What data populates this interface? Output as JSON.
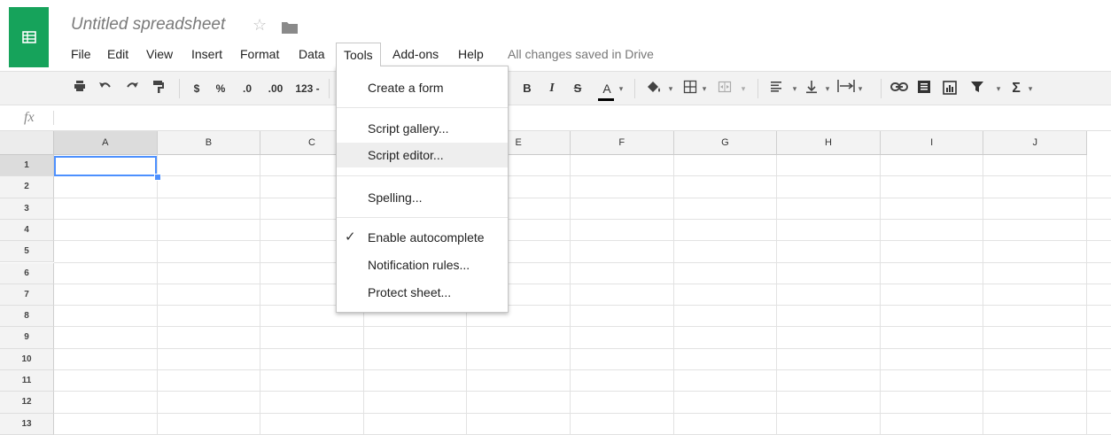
{
  "app": {
    "doc_title": "Untitled spreadsheet",
    "star_icon": "☆",
    "logo_icon": "sheets-logo-icon",
    "brand_color": "#16a35b"
  },
  "menubar": {
    "items": [
      "File",
      "Edit",
      "View",
      "Insert",
      "Format",
      "Data",
      "Tools",
      "Add-ons",
      "Help"
    ],
    "active": "Tools",
    "status": "All changes saved in Drive"
  },
  "toolbar": {
    "currency": "$",
    "percent": "%",
    "dec_less": ".0",
    "dec_more": ".00",
    "number_format": "123 -",
    "bold": "B",
    "italic": "I",
    "strike": "S",
    "text_color": "A",
    "sum": "Σ",
    "dropdown_caret": "▾"
  },
  "formula_bar": {
    "fx_label": "fx",
    "value": ""
  },
  "sheet": {
    "columns": [
      "A",
      "B",
      "C",
      "D",
      "E",
      "F",
      "G",
      "H",
      "I",
      "J"
    ],
    "rows": [
      "1",
      "2",
      "3",
      "4",
      "5",
      "6",
      "7",
      "8",
      "9",
      "10",
      "11",
      "12",
      "13"
    ],
    "active_cell": "A1",
    "selection_color": "#4d90fe"
  },
  "tools_menu": {
    "items": [
      {
        "label": "Create a form"
      },
      {
        "label": "Script gallery..."
      },
      {
        "label": "Script editor...",
        "hovered": true
      },
      {
        "label": "Spelling..."
      },
      {
        "label": "Enable autocomplete",
        "checked": true
      },
      {
        "label": "Notification rules..."
      },
      {
        "label": "Protect sheet..."
      }
    ],
    "check_glyph": "✓"
  }
}
